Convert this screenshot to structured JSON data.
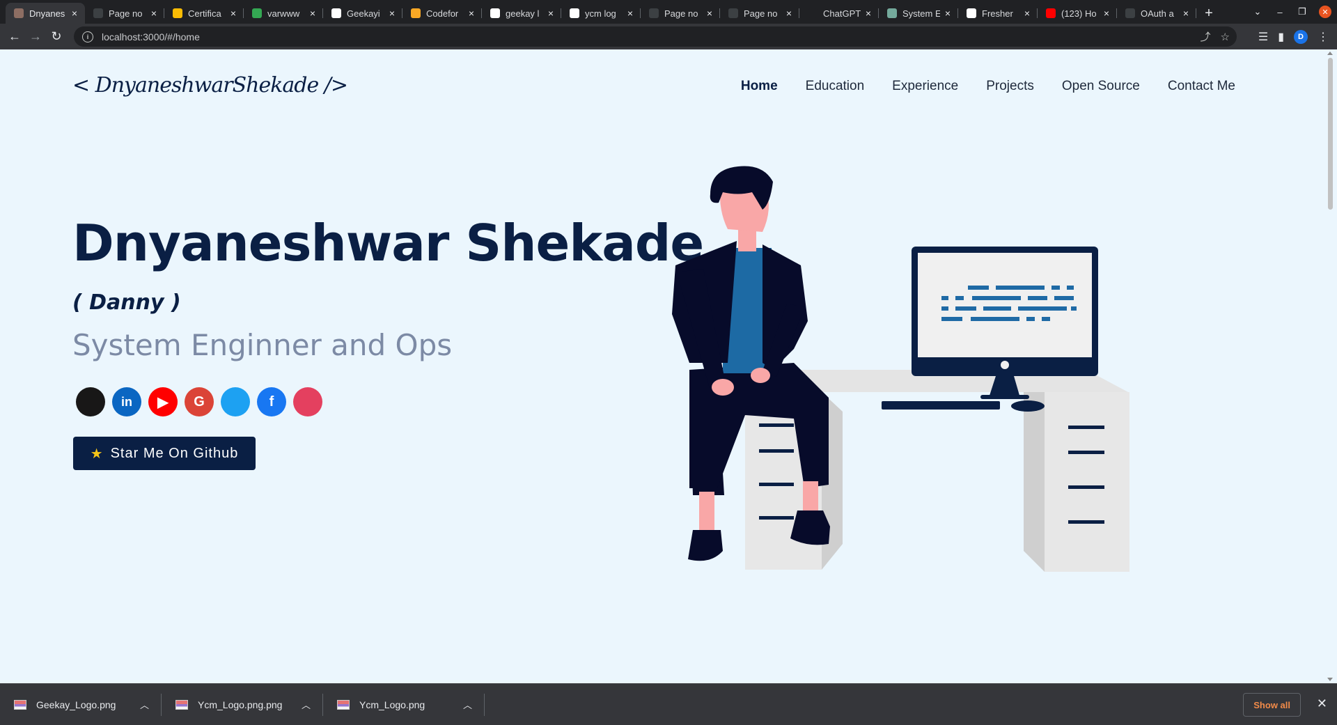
{
  "tabs": [
    {
      "label": "Dnyanes",
      "favicon_color": "#8d6e63"
    },
    {
      "label": "Page no",
      "favicon_color": "#3c4043"
    },
    {
      "label": "Certifica",
      "favicon_color": "#fbbc04"
    },
    {
      "label": "varwww",
      "favicon_color": "#34a853"
    },
    {
      "label": "Geekayi",
      "favicon_color": "#ffffff"
    },
    {
      "label": "Codefor",
      "favicon_color": "#f9a825"
    },
    {
      "label": "geekay l",
      "favicon_color": "#ffffff"
    },
    {
      "label": "ycm log",
      "favicon_color": "#ffffff"
    },
    {
      "label": "Page no",
      "favicon_color": "#3c4043"
    },
    {
      "label": "Page no",
      "favicon_color": "#3c4043"
    },
    {
      "label": "ChatGPT",
      "favicon_color": "#202124"
    },
    {
      "label": "System E",
      "favicon_color": "#74aa9c"
    },
    {
      "label": "Fresher",
      "favicon_color": "#ffffff"
    },
    {
      "label": "(123) Ho",
      "favicon_color": "#ff0000"
    },
    {
      "label": "OAuth a",
      "favicon_color": "#3c4043"
    }
  ],
  "browser": {
    "url": "localhost:3000/#/home",
    "profile_initial": "D"
  },
  "page": {
    "logo_text": "< DnyaneshwarShekade />",
    "nav": [
      {
        "label": "Home",
        "active": true
      },
      {
        "label": "Education",
        "active": false
      },
      {
        "label": "Experience",
        "active": false
      },
      {
        "label": "Projects",
        "active": false
      },
      {
        "label": "Open Source",
        "active": false
      },
      {
        "label": "Contact Me",
        "active": false
      }
    ],
    "name": "Dnyaneshwar Shekade",
    "nickname": "( Danny )",
    "role": "System Enginner and Ops",
    "socials": [
      {
        "name": "github",
        "glyph": "",
        "color": "#181717"
      },
      {
        "name": "linkedin",
        "glyph": "in",
        "color": "#0a66c2"
      },
      {
        "name": "youtube",
        "glyph": "▶",
        "color": "#ff0000"
      },
      {
        "name": "google",
        "glyph": "G",
        "color": "#db4437"
      },
      {
        "name": "twitter",
        "glyph": "",
        "color": "#1da1f2"
      },
      {
        "name": "facebook",
        "glyph": "f",
        "color": "#1877f2"
      },
      {
        "name": "instagram",
        "glyph": "",
        "color": "#e4405f"
      }
    ],
    "star_button": "Star Me On Github"
  },
  "downloads": {
    "items": [
      {
        "name": "Geekay_Logo.png"
      },
      {
        "name": "Ycm_Logo.png.png"
      },
      {
        "name": "Ycm_Logo.png"
      }
    ],
    "show_all": "Show all"
  },
  "colors": {
    "brand_navy": "#0a1f44",
    "page_bg": "#ebf6fd",
    "role_gray": "#7c8aa5"
  }
}
